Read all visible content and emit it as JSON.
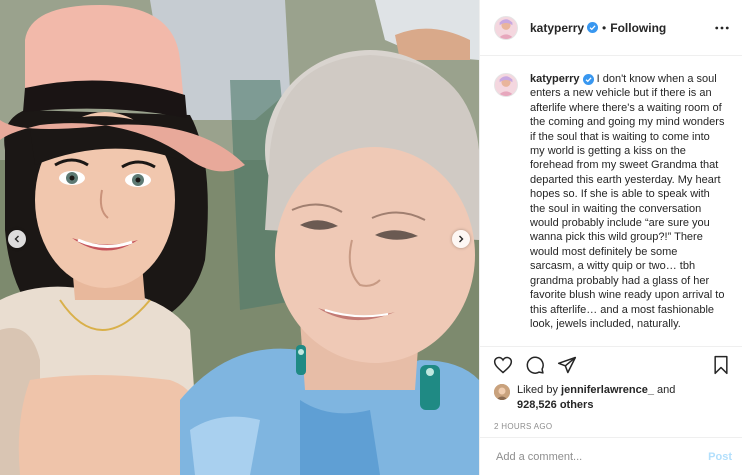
{
  "post": {
    "username": "katyperry",
    "follow_status": "Following",
    "separator": "•"
  },
  "caption": {
    "username": "katyperry",
    "text": "I don't know when a soul enters a new vehicle but if there is an afterlife where there's a waiting room of the coming and going my mind wonders if the soul that is waiting to come into my world is getting a kiss on the forehead from my sweet Grandma that departed this earth yesterday. My heart hopes so. If she is able to speak with the soul in waiting the conversation would probably include “are sure you wanna pick this wild group?!” There would most definitely be some sarcasm, a witty quip or two… tbh grandma probably had a glass of her favorite blush wine ready upon arrival to this afterlife… and a most fashionable look, jewels included, naturally."
  },
  "likes": {
    "prefix": "Liked by",
    "user": "jenniferlawrence_",
    "conjunction": "and",
    "count": "928,526 others"
  },
  "timestamp": "2 HOURS AGO",
  "comment": {
    "placeholder": "Add a comment...",
    "post_label": "Post"
  },
  "icons": {
    "verified": "verified-badge-icon",
    "more": "more-options-icon",
    "like": "heart-icon",
    "comment": "comment-icon",
    "share": "paper-plane-icon",
    "save": "bookmark-icon",
    "prev": "chevron-left-icon",
    "next": "chevron-right-icon"
  },
  "colors": {
    "verified_blue": "#3897f0",
    "post_button": "#b2dffc",
    "muted_text": "#8e8e8e",
    "border": "#efefef"
  }
}
